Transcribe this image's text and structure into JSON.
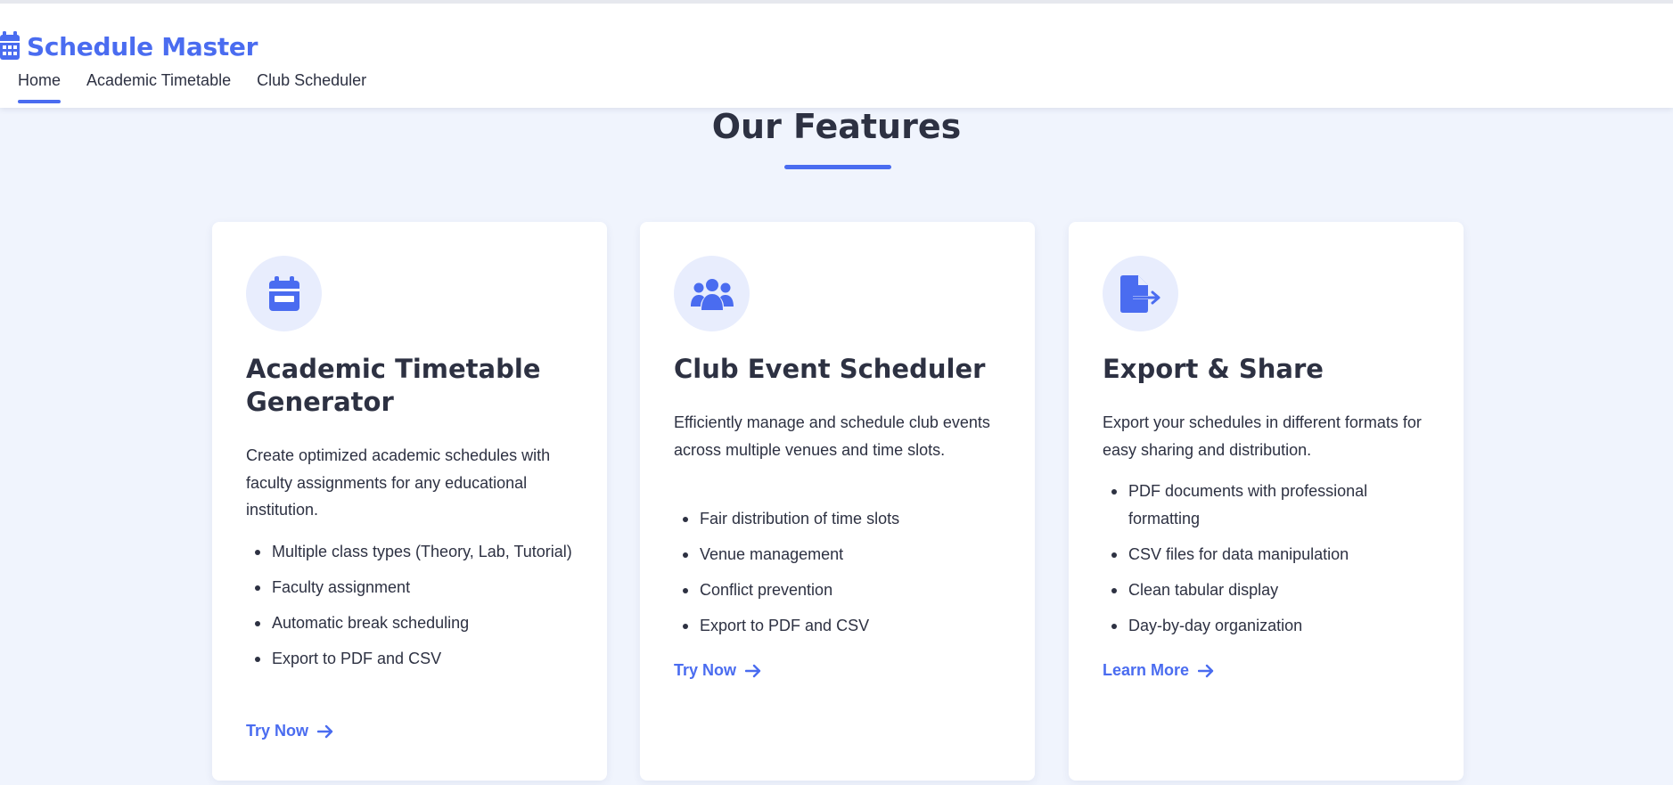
{
  "app": {
    "brand": "Schedule Master",
    "brand_icon": "calendar-icon",
    "accent_color": "#4a6cf0"
  },
  "nav": {
    "items": [
      {
        "label": "Home",
        "active": true
      },
      {
        "label": "Academic Timetable",
        "active": false
      },
      {
        "label": "Club Scheduler",
        "active": false
      }
    ]
  },
  "main": {
    "title": "Our Features",
    "cards": [
      {
        "icon": "calendar-icon",
        "title": "Academic Timetable Generator",
        "description": "Create optimized academic schedules with faculty assignments for any educational institution.",
        "features": [
          "Multiple class types (Theory, Lab, Tutorial)",
          "Faculty assignment",
          "Automatic break scheduling",
          "Export to PDF and CSV"
        ],
        "link": "Try Now",
        "link_icon": "arrow-right-icon"
      },
      {
        "icon": "users-icon",
        "title": "Club Event Scheduler",
        "description": "Efficiently manage and schedule club events across multiple venues and time slots.",
        "features": [
          "Fair distribution of time slots",
          "Venue management",
          "Conflict prevention",
          "Export to PDF and CSV"
        ],
        "link": "Try Now",
        "link_icon": "arrow-right-icon"
      },
      {
        "icon": "file-export-icon",
        "title": "Export & Share",
        "description": "Export your schedules in different formats for easy sharing and distribution.",
        "features": [
          "PDF documents with professional formatting",
          "CSV files for data manipulation",
          "Clean tabular display",
          "Day-by-day organization"
        ],
        "link": "Learn More",
        "link_icon": "arrow-right-icon"
      }
    ]
  }
}
